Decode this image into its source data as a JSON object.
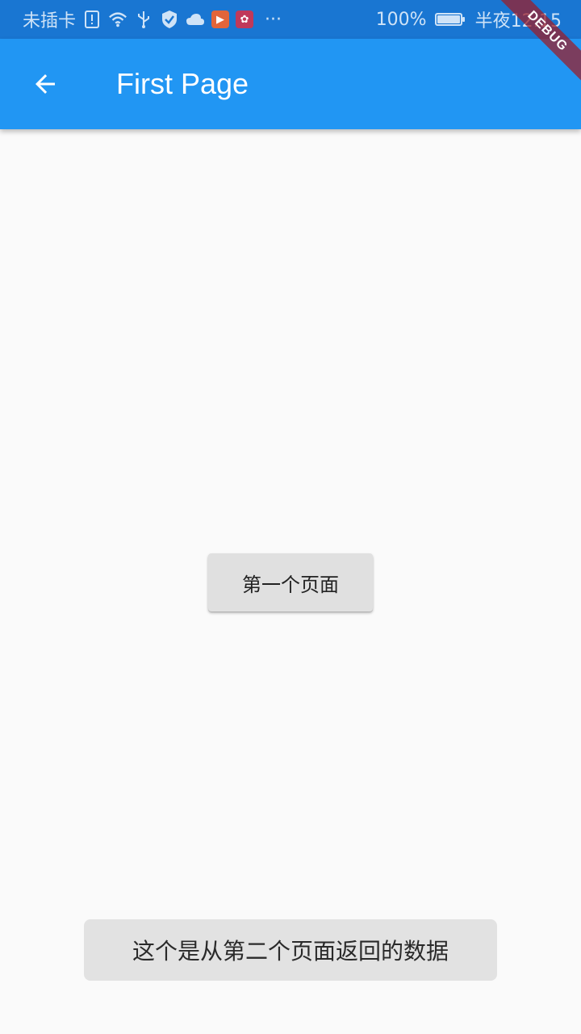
{
  "status_bar": {
    "carrier": "未插卡",
    "more": "···",
    "battery_pct": "100%",
    "battery_level": 1.0,
    "time": "半夜12:15",
    "icons": [
      "sim-alert-icon",
      "wifi-icon",
      "usb-icon",
      "shield-check-icon",
      "cloud-icon",
      "video-app-icon",
      "lotus-app-icon",
      "battery-charging-icon"
    ]
  },
  "app_bar": {
    "title": "First Page",
    "back_icon": "arrow-back-icon",
    "color": "#2196f3"
  },
  "debug_banner": "DEBUG",
  "main": {
    "button_label": "第一个页面"
  },
  "toast": {
    "message": "这个是从第二个页面返回的数据"
  }
}
